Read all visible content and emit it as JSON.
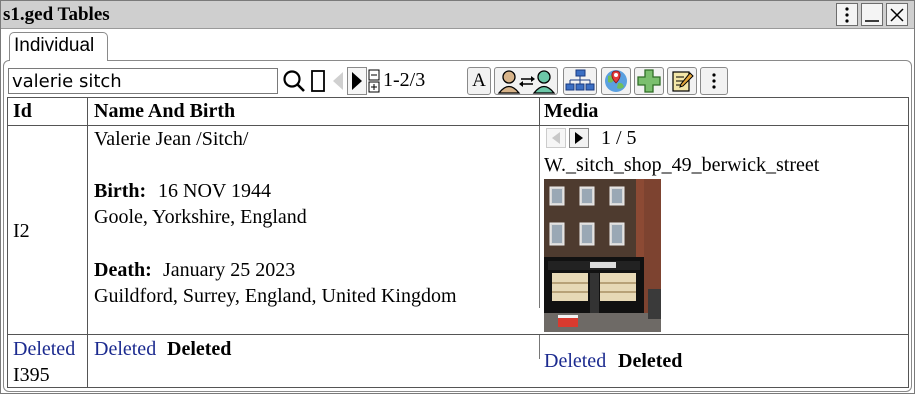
{
  "window": {
    "title": "s1.ged Tables",
    "menu_icon": "kebab-menu-icon",
    "minimize_icon": "minimize-icon",
    "close_icon": "close-icon"
  },
  "tabs": [
    {
      "label": "Individual",
      "selected": true
    }
  ],
  "toolbar": {
    "search_value": "valerie sitch",
    "result_count": "1-2/3",
    "font_button_label": "A",
    "icons": [
      "search-icon",
      "clear-filter-icon",
      "previous-icon",
      "next-icon",
      "expand-collapse-icon",
      "font-icon",
      "swap-persons-icon",
      "family-tree-icon",
      "map-pin-icon",
      "add-icon",
      "edit-icon",
      "more-menu-icon"
    ]
  },
  "table": {
    "headers": {
      "id": "Id",
      "name": "Name And Birth",
      "media": "Media"
    },
    "rows": [
      {
        "id": "I2",
        "name": "Valerie Jean /Sitch/",
        "birth_label": "Birth:",
        "birth_date": "16 NOV 1944",
        "birth_place": "Goole, Yorkshire, England",
        "death_label": "Death:",
        "death_date": "January 25 2023",
        "death_place": "Guildford, Surrey, England, United Kingdom",
        "media": {
          "counter": "1 / 5",
          "filename": "W._sitch_shop_49_berwick_street",
          "image": "storefront-photo"
        }
      },
      {
        "id_link": "Deleted",
        "id": "I395",
        "name_link": "Deleted",
        "name_bold": "Deleted",
        "media_link": "Deleted",
        "media_bold": "Deleted"
      }
    ]
  },
  "colors": {
    "titlebar": "#cfcfcf",
    "link": "#1b2a8f",
    "border": "#555555"
  }
}
